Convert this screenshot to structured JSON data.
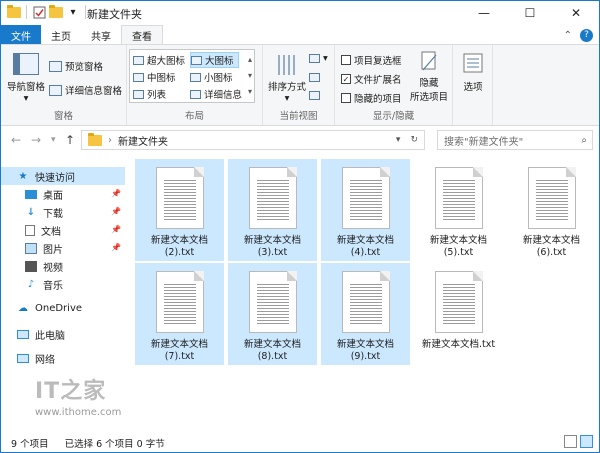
{
  "window": {
    "title": "新建文件夹"
  },
  "title_bar": {
    "window_controls": [
      "minimize-icon",
      "maximize-icon",
      "close-icon"
    ]
  },
  "ribbon_tabs": {
    "file": "文件",
    "home": "主页",
    "share": "共享",
    "view": "查看"
  },
  "ribbon": {
    "panes": {
      "nav_pane": "导航窗格",
      "preview_pane": "预览窗格",
      "details_pane": "详细信息窗格",
      "label": "窗格"
    },
    "layout": {
      "extra_large": "超大图标",
      "large": "大图标",
      "medium": "中图标",
      "small": "小图标",
      "list": "列表",
      "details": "详细信息",
      "label": "布局"
    },
    "current_view": {
      "sort_by": "排序方式",
      "label": "当前视图"
    },
    "show_hide": {
      "item_checkboxes": "项目复选框",
      "file_extensions": "文件扩展名",
      "hidden_items": "隐藏的项目",
      "hide_selected_line1": "隐藏",
      "hide_selected_line2": "所选项目",
      "label": "显示/隐藏",
      "item_checkboxes_checked": false,
      "file_extensions_checked": true,
      "hidden_items_checked": false
    },
    "options": {
      "label": "选项"
    }
  },
  "address": {
    "path": "新建文件夹",
    "search_placeholder": "搜索\"新建文件夹\""
  },
  "nav_pane": {
    "quick_access": "快速访问",
    "items": [
      {
        "label": "桌面",
        "icon": "desktop-icon",
        "pinned": true
      },
      {
        "label": "下载",
        "icon": "download-icon",
        "pinned": true
      },
      {
        "label": "文档",
        "icon": "documents-icon",
        "pinned": true
      },
      {
        "label": "图片",
        "icon": "pictures-icon",
        "pinned": true
      },
      {
        "label": "视频",
        "icon": "videos-icon",
        "pinned": false
      },
      {
        "label": "音乐",
        "icon": "music-icon",
        "pinned": false
      }
    ],
    "onedrive": "OneDrive",
    "this_pc": "此电脑",
    "network": "网络"
  },
  "files": [
    {
      "line1": "新建文本文档",
      "line2": "(2).txt",
      "selected": true
    },
    {
      "line1": "新建文本文档",
      "line2": "(3).txt",
      "selected": true
    },
    {
      "line1": "新建文本文档",
      "line2": "(4).txt",
      "selected": true
    },
    {
      "line1": "新建文本文档",
      "line2": "(5).txt",
      "selected": false
    },
    {
      "line1": "新建文本文档",
      "line2": "(6).txt",
      "selected": false
    },
    {
      "line1": "新建文本文档",
      "line2": "(7).txt",
      "selected": true
    },
    {
      "line1": "新建文本文档",
      "line2": "(8).txt",
      "selected": true
    },
    {
      "line1": "新建文本文档",
      "line2": "(9).txt",
      "selected": true
    },
    {
      "line1": "新建文本文档.txt",
      "line2": "",
      "selected": false
    }
  ],
  "watermark": {
    "logo": "IT之家",
    "url": "www.ithome.com"
  },
  "status_bar": {
    "item_count": "9 个项目",
    "selection": "已选择 6 个项目  0 字节"
  },
  "colors": {
    "accent": "#1979ca",
    "selection": "#cce8ff",
    "ribbon_bg": "#f5f6f7"
  }
}
